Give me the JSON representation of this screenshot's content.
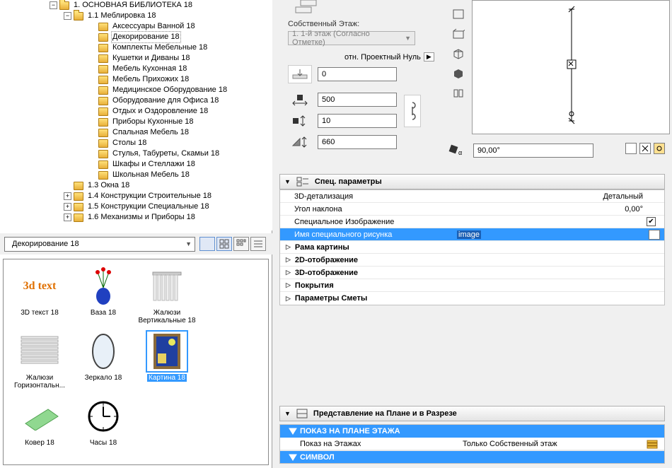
{
  "tree": {
    "root": "1. ОСНОВНАЯ БИБЛИОТЕКА 18",
    "n1_1": "1.1 Меблировка 18",
    "items": [
      "Аксессуары Ванной 18",
      "Декорирование 18",
      "Комплекты Мебельные 18",
      "Кушетки и Диваны 18",
      "Мебель Кухонная 18",
      "Мебель Прихожих 18",
      "Медицинское Оборудование 18",
      "Оборудование для Офиса 18",
      "Отдых и Оздоровление 18",
      "Приборы Кухонные 18",
      "Спальная Мебель 18",
      "Столы 18",
      "Стулья, Табуреты, Скамьи 18",
      "Шкафы и Стеллажи 18",
      "Школьная Мебель 18"
    ],
    "n1_3": "1.3 Окна 18",
    "n1_4": "1.4 Конструкции Строительные 18",
    "n1_5": "1.5 Конструкции Специальные 18",
    "n1_6": "1.6 Механизмы и Приборы 18"
  },
  "lib_combo": "Декорирование 18",
  "thumbs": {
    "t0": "3D текст 18",
    "t1": "Ваза 18",
    "t2": "Жалюзи Вертикальные 18",
    "t3": "Жалюзи Горизонтальн...",
    "t4": "Зеркало 18",
    "t5": "Картина 18",
    "t6": "Ковер 18",
    "t7": "Часы 18"
  },
  "rt": {
    "own_floor": "Собственный Этаж:",
    "floor_combo": "1. 1-й этаж (Согласно Отметке)",
    "rel_zero": "отн. Проектный Нуль",
    "v0": "0",
    "v1": "500",
    "v2": "10",
    "v3": "660",
    "angle": "90,00°"
  },
  "sections": {
    "spec": "Спец. параметры",
    "plan": "Представление на Плане и в Разрезе"
  },
  "params": {
    "p0k": "3D-детализация",
    "p0v": "Детальный",
    "p1k": "Угол наклона",
    "p1v": "0,00°",
    "p2k": "Специальное Изображение",
    "p3k": "Имя специального рисунка",
    "p3v": "image",
    "g0": "Рама картины",
    "g1": "2D-отображение",
    "g2": "3D-отображение",
    "g3": "Покрытия",
    "g4": "Параметры Сметы"
  },
  "plan": {
    "h0": "ПОКАЗ НА ПЛАНЕ ЭТАЖА",
    "r0k": "Показ на Этажах",
    "r0v": "Только Собственный этаж",
    "h1": "СИМВОЛ"
  }
}
